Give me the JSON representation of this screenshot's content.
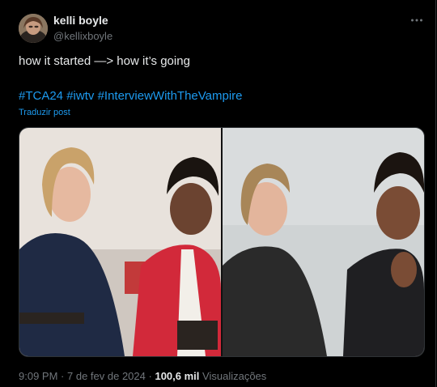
{
  "author": {
    "display_name": "kelli boyle",
    "handle": "@kellixboyle"
  },
  "tweet": {
    "text": "how it started —> how it’s going",
    "hashtags": [
      "#TCA24",
      "#iwtv",
      "#InterviewWithTheVampire"
    ],
    "translate_label": "Traduzir post"
  },
  "meta": {
    "time": "9:09 PM",
    "separator": "·",
    "date": "7 de fev de 2024",
    "views_count": "100,6 mil",
    "views_label": "Visualizações"
  },
  "icons": {
    "more": "more-horizontal-icon"
  },
  "colors": {
    "background": "#000000",
    "text": "#e7e9ea",
    "secondary": "#71767b",
    "link": "#1d9bf0"
  }
}
